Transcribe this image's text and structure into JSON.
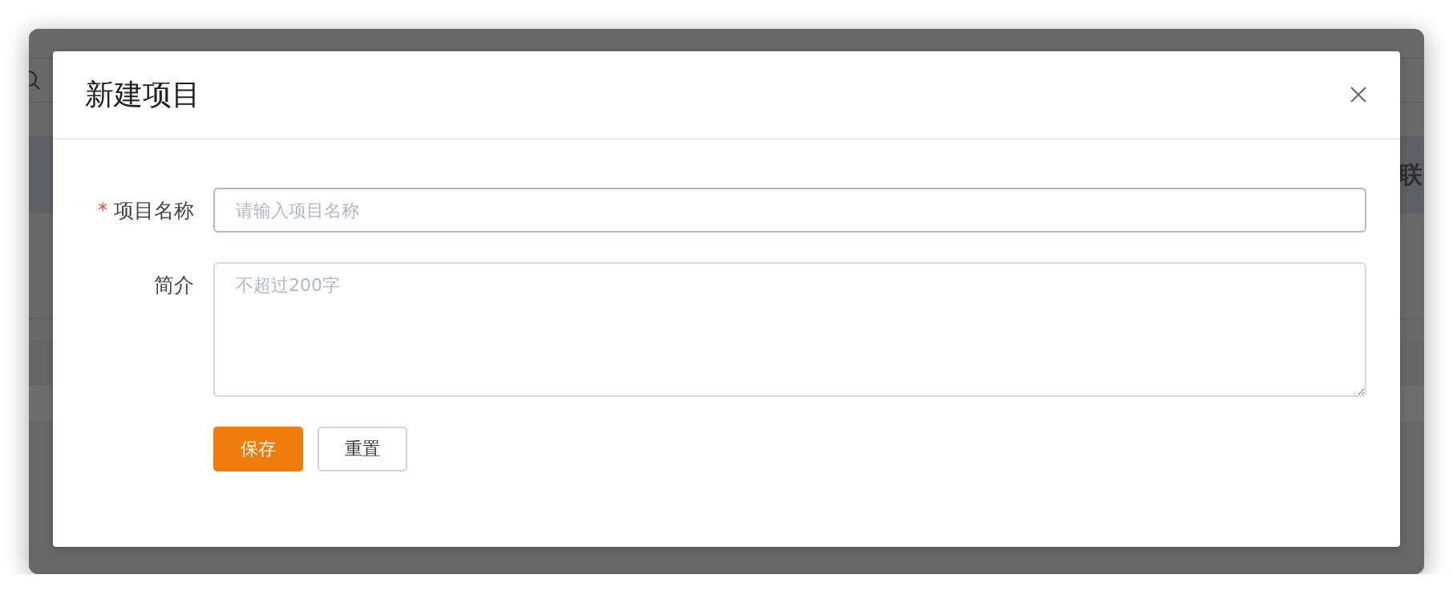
{
  "background": {
    "column_text": "联"
  },
  "dialog": {
    "title": "新建项目",
    "required_mark": "*",
    "fields": [
      {
        "kind": "input",
        "label": "项目名称",
        "required": true,
        "placeholder": "请输入项目名称"
      },
      {
        "kind": "textarea",
        "label": "简介",
        "required": false,
        "placeholder": "不超过200字"
      }
    ],
    "buttons": [
      {
        "kind": "primary",
        "label": "保存"
      },
      {
        "kind": "default",
        "label": "重置"
      }
    ]
  }
}
